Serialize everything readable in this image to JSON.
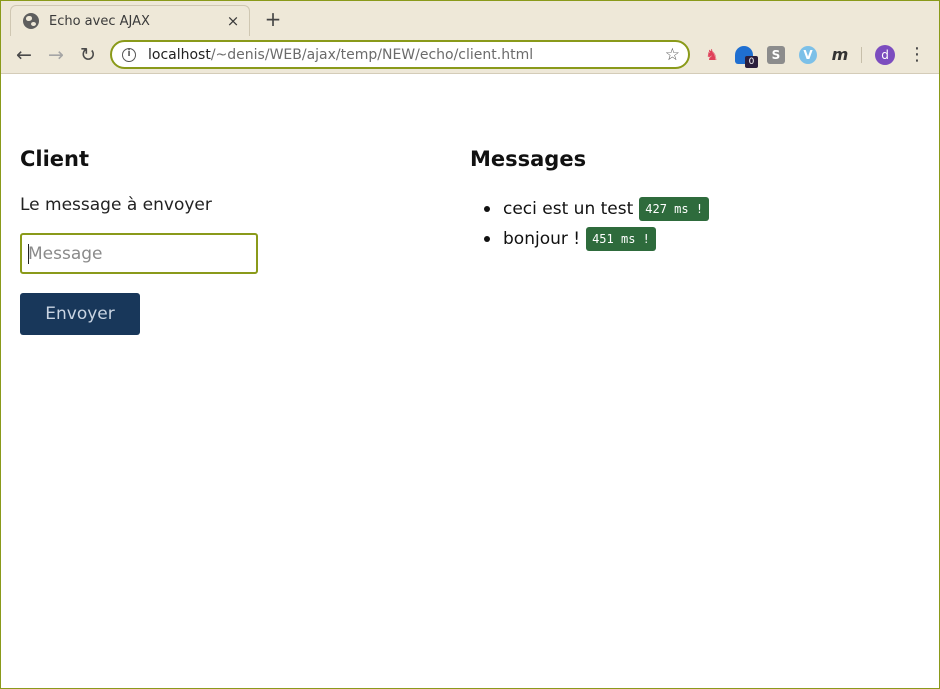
{
  "browser": {
    "tab_title": "Echo avec AJAX",
    "tab_close": "×",
    "new_tab": "+",
    "url_host": "localhost",
    "url_path": "/~denis/WEB/ajax/temp/NEW/echo/client.html",
    "extension_badge": "0",
    "extension_s": "S",
    "extension_v": "V",
    "extension_m": "m",
    "profile_initial": "d",
    "accent_color": "#8a9a1a"
  },
  "client": {
    "heading": "Client",
    "label": "Le message à envoyer",
    "input_placeholder": "Message",
    "input_value": "",
    "send_label": "Envoyer"
  },
  "messages": {
    "heading": "Messages",
    "items": [
      {
        "text": "ceci est un test",
        "latency": "427 ms !"
      },
      {
        "text": "bonjour !",
        "latency": "451 ms !"
      }
    ]
  }
}
